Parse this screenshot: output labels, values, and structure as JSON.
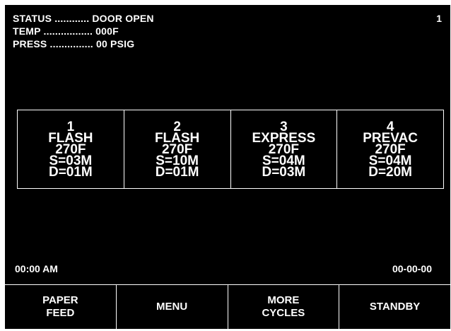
{
  "status": {
    "status_line": "STATUS ............ DOOR OPEN",
    "temp_line": "TEMP ................. 000F",
    "press_line": "PRESS ............... 00 PSIG",
    "screen_number": "1"
  },
  "cycles": [
    {
      "number": "1",
      "name": "FLASH",
      "temp": "270F",
      "sterilize": "S=03M",
      "dry": "D=01M"
    },
    {
      "number": "2",
      "name": "FLASH",
      "temp": "270F",
      "sterilize": "S=10M",
      "dry": "D=01M"
    },
    {
      "number": "3",
      "name": "EXPRESS",
      "temp": "270F",
      "sterilize": "S=04M",
      "dry": "D=03M"
    },
    {
      "number": "4",
      "name": "PREVAC",
      "temp": "270F",
      "sterilize": "S=04M",
      "dry": "D=20M"
    }
  ],
  "footer": {
    "time": "00:00 AM",
    "date": "00-00-00"
  },
  "softkeys": [
    {
      "line1": "PAPER",
      "line2": "FEED"
    },
    {
      "line1": "MENU",
      "line2": ""
    },
    {
      "line1": "MORE",
      "line2": "CYCLES"
    },
    {
      "line1": "STANDBY",
      "line2": ""
    }
  ]
}
